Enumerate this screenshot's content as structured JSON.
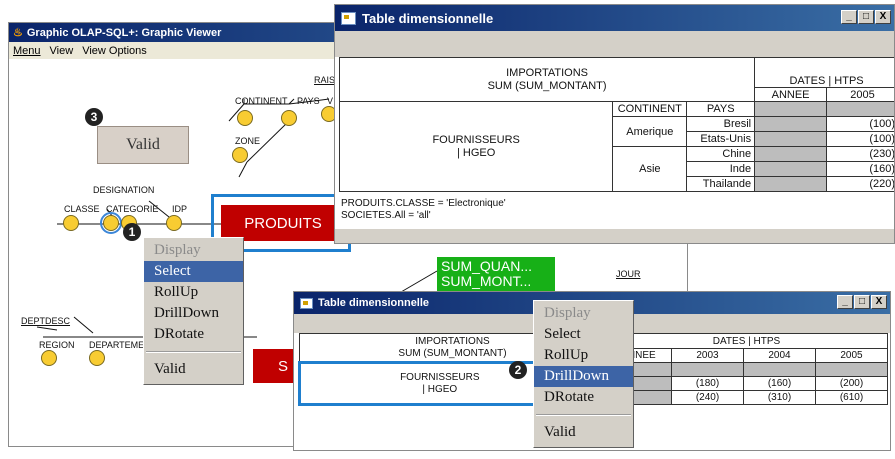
{
  "viewer": {
    "title": "Graphic OLAP-SQL+: Graphic Viewer",
    "menu": [
      "Menu",
      "View",
      "View Options"
    ],
    "labels": {
      "rais": "RAIS",
      "continent": "CONTINENT",
      "pays": "PAYS",
      "v": "V",
      "zone": "ZONE",
      "designation": "DESIGNATION",
      "classe": "CLASSE",
      "categorie": "CATEGORIE",
      "idp": "IDP",
      "deptdesc": "DEPTDESC",
      "region": "REGION",
      "departement": "DEPARTEME",
      "jour": "JOUR"
    },
    "valid_box": "Valid",
    "fact_box": "PRODUITS",
    "red_box_2": "S",
    "measures": [
      "SUM_QUAN...",
      "SUM_MONT..."
    ],
    "badges": [
      "1",
      "2",
      "3"
    ]
  },
  "menu1": {
    "items": [
      "Display",
      "Select",
      "RollUp",
      "DrillDown",
      "DRotate"
    ],
    "valid": "Valid",
    "disabled": "Display",
    "highlighted": "Select"
  },
  "menu2": {
    "items": [
      "Display",
      "Select",
      "RollUp",
      "DrillDown",
      "DRotate"
    ],
    "valid": "Valid",
    "disabled": "Display",
    "highlighted": "DrillDown"
  },
  "table1": {
    "title": "Table dimensionnelle",
    "fact": "IMPORTATIONS",
    "measure": "SUM (SUM_MONTANT)",
    "col_dim": "DATES | HTPS",
    "col_level": "ANNEE",
    "col_value": "2005",
    "row_dim_name": "FOURNISSEURS",
    "row_dim_hier": "| HGEO",
    "row_headers": [
      "CONTINENT",
      "PAYS"
    ],
    "rows": [
      {
        "continent": "Amerique",
        "pays": "Bresil",
        "value": "(100)"
      },
      {
        "continent": "Amerique",
        "pays": "Etats-Unis",
        "value": "(100)"
      },
      {
        "continent": "Asie",
        "pays": "Chine",
        "value": "(230)"
      },
      {
        "continent": "Asie",
        "pays": "Inde",
        "value": "(160)"
      },
      {
        "continent": "Asie",
        "pays": "Thailande",
        "value": "(220)"
      }
    ],
    "conditions": [
      "PRODUITS.CLASSE = 'Electronique'",
      "SOCIETES.All = 'all'"
    ]
  },
  "table2": {
    "title": "Table dimensionnelle",
    "fact": "IMPORTATIONS",
    "measure": "SUM (SUM_MONTANT)",
    "col_dim": "DATES | HTPS",
    "col_level": "ANNEE",
    "years": [
      "2003",
      "2004",
      "2005"
    ],
    "row_dim_name": "FOURNISSEURS",
    "row_dim_hier": "| HGEO",
    "rows": [
      [
        "(180)",
        "(160)",
        "(200)"
      ],
      [
        "(240)",
        "(310)",
        "(610)"
      ]
    ]
  },
  "window_buttons": [
    "_",
    "□",
    "X"
  ],
  "colors": {
    "title_bar": "#0a246a",
    "node_yellow": "#f8cc32",
    "fact_red": "#c00000",
    "measure_green": "#17b017",
    "select_blue": "#1f7fce",
    "menu_highlight": "#3d64a6"
  }
}
